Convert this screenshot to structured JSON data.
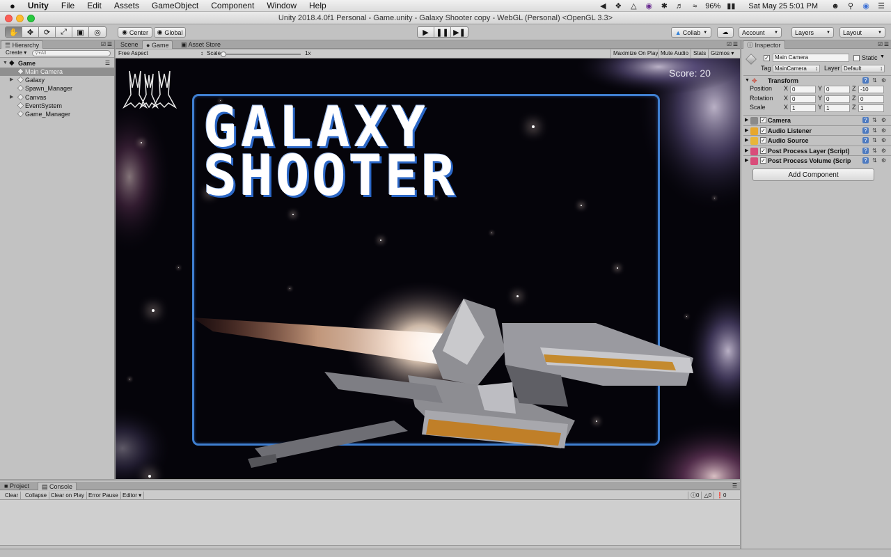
{
  "menubar": {
    "apple": "",
    "app": "Unity",
    "items": [
      "File",
      "Edit",
      "Assets",
      "GameObject",
      "Component",
      "Window",
      "Help"
    ],
    "battery": "96%",
    "datetime": "Sat May 25  5:01 PM"
  },
  "window": {
    "title": "Unity 2018.4.0f1 Personal - Game.unity - Galaxy Shooter copy - WebGL (Personal) <OpenGL 3.3>"
  },
  "toolbar": {
    "pivot": "Center",
    "space": "Global",
    "collab": "Collab",
    "account": "Account",
    "layers": "Layers",
    "layout": "Layout"
  },
  "hierarchy": {
    "tab": "Hierarchy",
    "create": "Create",
    "search_placeholder": "All",
    "scene": "Game",
    "items": [
      {
        "name": "Main Camera",
        "selected": true,
        "expandable": false
      },
      {
        "name": "Galaxy",
        "selected": false,
        "expandable": true
      },
      {
        "name": "Spawn_Manager",
        "selected": false,
        "expandable": false
      },
      {
        "name": "Canvas",
        "selected": false,
        "expandable": true
      },
      {
        "name": "EventSystem",
        "selected": false,
        "expandable": false
      },
      {
        "name": "Game_Manager",
        "selected": false,
        "expandable": false
      }
    ]
  },
  "center_tabs": {
    "scene": "Scene",
    "game": "Game",
    "asset_store": "Asset Store"
  },
  "game_bar": {
    "aspect": "Free Aspect",
    "scale_label": "Scale",
    "scale_value": "1x",
    "maximize": "Maximize On Play",
    "mute": "Mute Audio",
    "stats": "Stats",
    "gizmos": "Gizmos"
  },
  "game_view": {
    "score": "Score:  20",
    "title_line1": "GALAXY",
    "title_line2": "SHOOTER",
    "lives": 3,
    "colors": {
      "frame": "#3f7fd0",
      "title": "#ffffff",
      "title_shadow": "#2b67c6",
      "engine": "#ffe3c4"
    }
  },
  "inspector": {
    "tab": "Inspector",
    "object_name": "Main Camera",
    "static_label": "Static",
    "tag_label": "Tag",
    "tag_value": "MainCamera",
    "layer_label": "Layer",
    "layer_value": "Default",
    "transform": {
      "title": "Transform",
      "position_label": "Position",
      "rotation_label": "Rotation",
      "scale_label": "Scale",
      "axis_x": "X",
      "axis_y": "Y",
      "axis_z": "Z",
      "position": [
        "0",
        "0",
        "-10"
      ],
      "rotation": [
        "0",
        "0",
        "0"
      ],
      "scale": [
        "1",
        "1",
        "1"
      ]
    },
    "components": [
      {
        "name": "Camera",
        "icon": "camera-icon",
        "color": "#8a8a8a"
      },
      {
        "name": "Audio Listener",
        "icon": "audio-listener-icon",
        "color": "#e7a72c"
      },
      {
        "name": "Audio Source",
        "icon": "audio-source-icon",
        "color": "#e8b53a"
      },
      {
        "name": "Post Process Layer (Script)",
        "icon": "post-process-icon",
        "color": "#d94c7a"
      },
      {
        "name": "Post Process Volume (Scrip",
        "icon": "post-process-icon",
        "color": "#d94c7a"
      }
    ],
    "add_component": "Add Component"
  },
  "bottom": {
    "project_tab": "Project",
    "console_tab": "Console",
    "buttons": [
      "Clear",
      "Collapse",
      "Clear on Play",
      "Error Pause",
      "Editor"
    ],
    "counts": [
      "0",
      "0",
      "0"
    ]
  }
}
